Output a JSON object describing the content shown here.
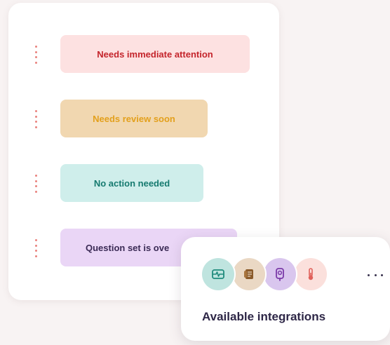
{
  "status_list": {
    "items": [
      {
        "label": "Needs immediate attention",
        "color": "#c4242b",
        "background": "#fde1e1"
      },
      {
        "label": "Needs review soon",
        "color": "#e3a01c",
        "background": "#f1d7b0"
      },
      {
        "label": "No action needed",
        "color": "#157a6f",
        "background": "#cfeeeb"
      },
      {
        "label": "Question set is ove",
        "color": "#3a2a55",
        "background": "#ead6f6"
      }
    ],
    "drag_handle_icon": "drag-handle-icon"
  },
  "integrations": {
    "title": "Available integrations",
    "icons": [
      {
        "name": "ecg-monitor-icon",
        "background": "#bfe4df"
      },
      {
        "name": "document-scroll-icon",
        "background": "#ead8c4"
      },
      {
        "name": "glucose-meter-icon",
        "background": "#d9c6ee"
      },
      {
        "name": "thermometer-icon",
        "background": "#fbe0dc"
      }
    ],
    "more_icon": "more-horizontal-icon"
  }
}
